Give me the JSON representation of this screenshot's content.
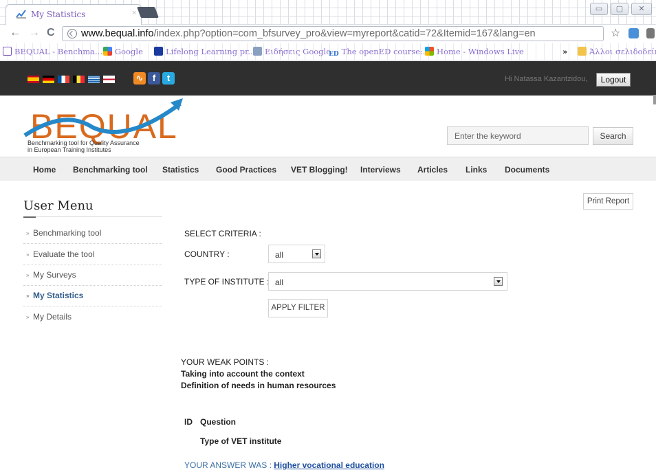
{
  "browser": {
    "tab_title": "My Statistics",
    "tab_close": "×",
    "url_domain": "www.bequal.info",
    "url_path": "/index.php?option=com_bfsurvey_pro&view=myreport&catid=72&Itemid=167&lang=en",
    "bookmarks": [
      "BEQUAL - Benchma...",
      "Google",
      "Lifelong Learning pr...",
      "Ειδήσεις Google",
      "The openED course:...",
      "Home - Windows Live"
    ],
    "bookmarks_overflow": "»",
    "other_bookmarks": "Άλλοι σελιδοδείκτες",
    "bookmark_badge": "ED",
    "back_glyph": "←",
    "forward_glyph": "→",
    "reload_glyph": "C",
    "star_glyph": "☆",
    "min_glyph": "▭",
    "max_glyph": "▢",
    "close_glyph": "✕"
  },
  "header": {
    "greeting": "Hi Natassa Kazantzidou,",
    "logout_label": "Logout",
    "social_labels": [
      "f",
      "t"
    ],
    "logo_text": "BEQUAL",
    "logo_tagline_1": "Benchmarking tool for Quality Assurance",
    "logo_tagline_2": "in European Training Institutes",
    "search_placeholder": "Enter the keyword",
    "search_label": "Search"
  },
  "nav": {
    "items": [
      "Home",
      "Benchmarking tool",
      "Statistics",
      "Good Practices",
      "VET Blogging!",
      "Interviews",
      "Articles",
      "Links",
      "Documents"
    ]
  },
  "sidebar": {
    "title": "User Menu",
    "items": [
      "Benchmarking tool",
      "Evaluate the tool",
      "My Surveys",
      "My Statistics",
      "My Details"
    ],
    "active": "My Statistics"
  },
  "content": {
    "print_label": "Print Report",
    "select_criteria": "SELECT CRITERIA :",
    "country_label": "COUNTRY :",
    "country_value": "all",
    "institute_label": "TYPE OF INSTITUTE :",
    "institute_value": "all",
    "apply_label": "APPLY FILTER",
    "weak_points_title": "YOUR WEAK POINTS :",
    "weak_points": [
      "Taking into account the context",
      "Definition of needs in human resources"
    ],
    "table_id_header": "ID",
    "table_question_header": "Question",
    "question_text": "Type of VET institute",
    "answer_prefix": "YOUR ANSWER WAS :",
    "answer_value": "Higher vocational education"
  }
}
